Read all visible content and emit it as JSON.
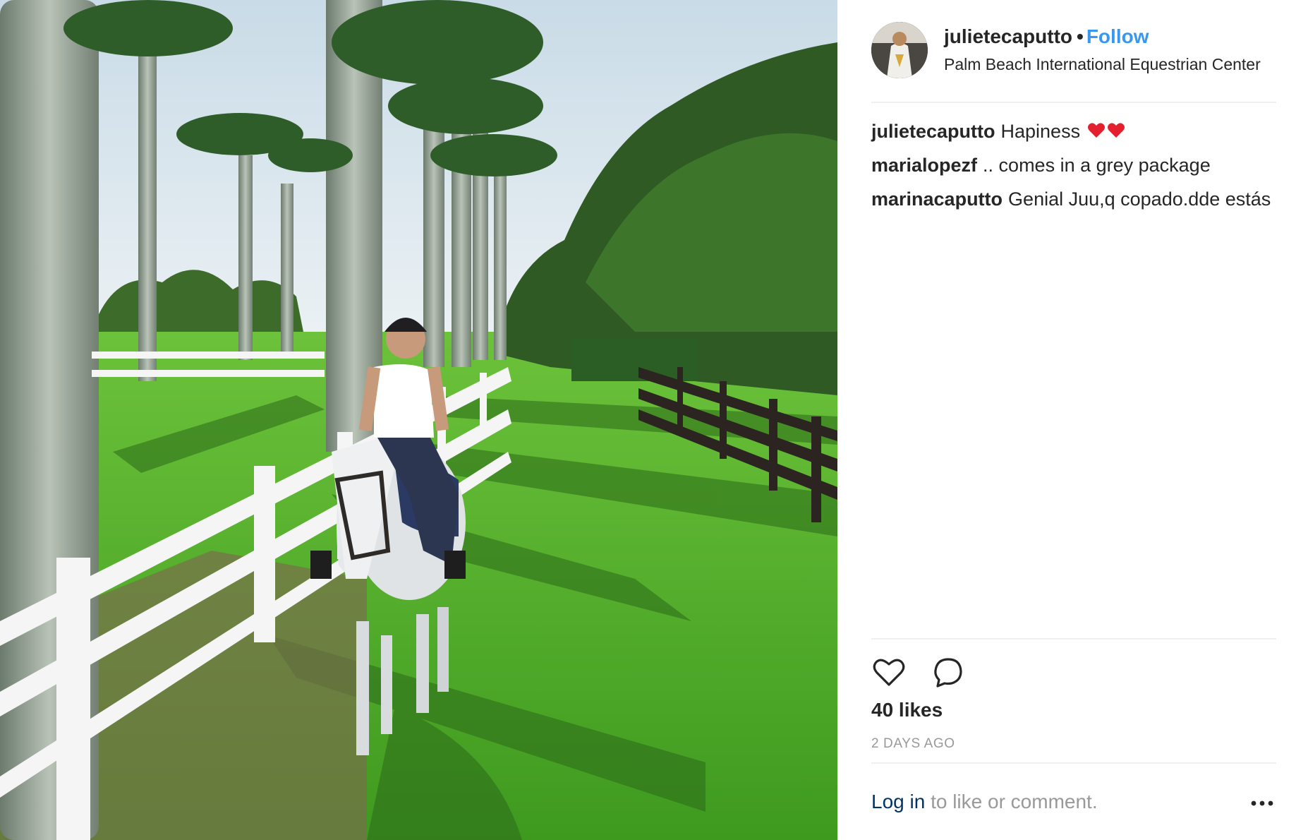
{
  "post": {
    "username": "julietecaputto",
    "separator": "•",
    "follow_label": "Follow",
    "location": "Palm Beach International Equestrian Center",
    "comments": [
      {
        "author": "julietecaputto",
        "text": "Hapiness",
        "emoji": "two-red-hearts"
      },
      {
        "author": "marialopezf",
        "text": ".. comes in a grey package"
      },
      {
        "author": "marinacaputto",
        "text": "Genial Juu,q copado.dde estás"
      }
    ],
    "likes": "40 likes",
    "time": "2 DAYS AGO",
    "footer": {
      "login_label": "Log in",
      "rest": " to like or comment."
    },
    "icons": {
      "like": "heart-outline-icon",
      "comment": "speech-bubble-icon",
      "more": "ellipsis-icon"
    },
    "colors": {
      "follow": "#3897f0",
      "login_link": "#003569",
      "muted": "#999999",
      "text": "#262626"
    }
  }
}
